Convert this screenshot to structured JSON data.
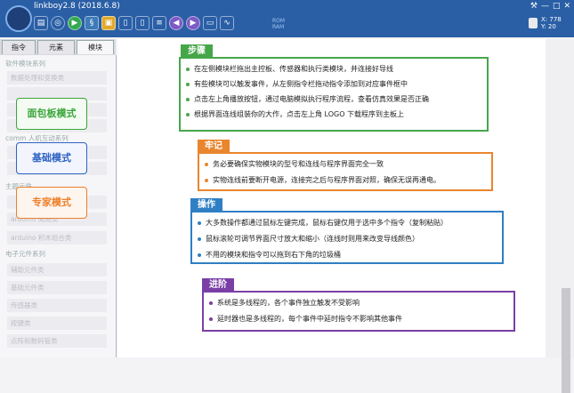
{
  "app": {
    "title": "linkboy2.8 (2018.6.8)"
  },
  "toolbar": {
    "icons": [
      "folder-open-icon",
      "browser-icon",
      "play-icon",
      "python-icon",
      "save-icon",
      "doc-icon",
      "doc-copy-icon",
      "list-icon",
      "back-icon",
      "forward-icon",
      "monitor-icon",
      "chart-icon"
    ],
    "ram_label": "ROM\nRAM"
  },
  "coords": {
    "x": "X: 778",
    "y": "Y: 20"
  },
  "tabs": [
    "指令",
    "元素",
    "模块"
  ],
  "sidebar": {
    "section1": "软件模块系列",
    "items1": [
      "数据处理和变换类",
      "",
      "",
      "",
      "",
      "",
      ""
    ],
    "section2": "comm 人机互动系列",
    "section3": "主题元件",
    "items2": [
      "arduino 基础类",
      "arduino 简易类",
      "arduino 积木组合类"
    ],
    "section4": "电子元件系列",
    "items3": [
      "辅助元件类",
      "基础元件类",
      "传感器类",
      "按键类",
      "点阵和数码管类"
    ]
  },
  "modes": [
    {
      "label": "面包板模式",
      "color": "#3aa63a",
      "bg": "#f3fbf2"
    },
    {
      "label": "基础模式",
      "color": "#2e62c4",
      "bg": "#f2f5fd"
    },
    {
      "label": "专家模式",
      "color": "#ee7f2a",
      "bg": "#fdf5ee"
    }
  ],
  "boxes": [
    {
      "title": "步骤",
      "color": "#46a64a",
      "items": [
        "在左侧模块栏拖出主控板、传感器和执行类模块，并连接好导线",
        "有些模块可以触发事件，从左侧指令栏拖动指令添加到对应事件框中",
        "点击左上角播放按钮，通过电脑模拟执行程序流程，查看仿真效果是否正确",
        "根据界面连线组装你的大作，点击左上角 LOGO 下载程序到主板上"
      ]
    },
    {
      "title": "牢记",
      "color": "#e8862e",
      "items": [
        "务必要确保实物模块的型号和连线与程序界面完全一致",
        "实物连线前要断开电源，连接完之后与程序界面对照，确保无误再通电。"
      ]
    },
    {
      "title": "操作",
      "color": "#2f7fc4",
      "items": [
        "大多数操作都通过鼠标左键完成，鼠标右键仅用于选中多个指令（复制粘贴）",
        "鼠标滚轮可调节界面尺寸放大和缩小（连线时则用来改变导线颜色）",
        "不用的模块和指令可以拖到右下角的垃圾桶"
      ]
    },
    {
      "title": "进阶",
      "color": "#7a3fa6",
      "items": [
        "系统是多线程的，各个事件独立触发不受影响",
        "延时器也是多线程的，每个事件中延时指令不影响其他事件"
      ]
    }
  ]
}
